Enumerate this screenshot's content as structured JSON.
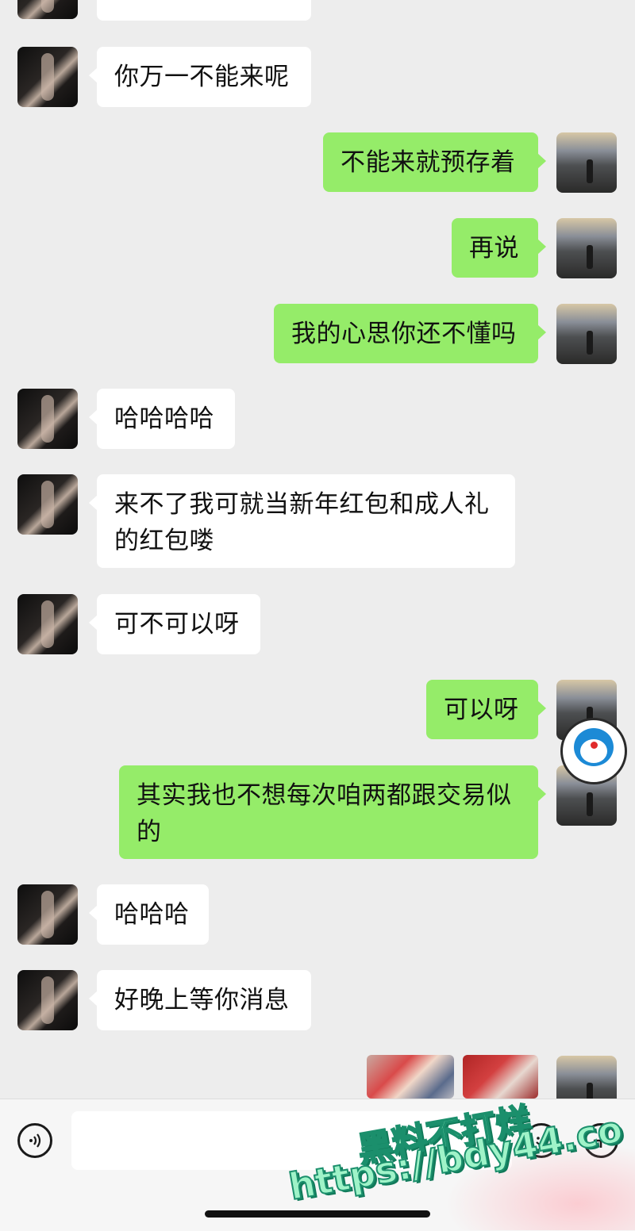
{
  "messages": [
    {
      "side": "left",
      "text": ""
    },
    {
      "side": "left",
      "text": "你万一不能来呢"
    },
    {
      "side": "right",
      "text": "不能来就预存着"
    },
    {
      "side": "right",
      "text": "再说"
    },
    {
      "side": "right",
      "text": "我的心思你还不懂吗"
    },
    {
      "side": "left",
      "text": "哈哈哈哈"
    },
    {
      "side": "left",
      "text": "来不了我可就当新年红包和成人礼的红包喽"
    },
    {
      "side": "left",
      "text": "可不可以呀"
    },
    {
      "side": "right",
      "text": "可以呀"
    },
    {
      "side": "right",
      "text": "其实我也不想每次咱两都跟交易似的"
    },
    {
      "side": "left",
      "text": "哈哈哈"
    },
    {
      "side": "left",
      "text": "好晚上等你消息"
    }
  ],
  "image_message": {
    "side": "right",
    "icon": "image-thumbnail"
  },
  "input_bar": {
    "voice_icon": "voice-icon",
    "emoji_icon": "emoji-icon",
    "plus_icon": "plus-icon",
    "input_value": ""
  },
  "watermark": {
    "line1": "黑料不打烊",
    "line2": "https://bdy44.co"
  },
  "colors": {
    "background": "#ededed",
    "incoming_bubble": "#ffffff",
    "outgoing_bubble": "#95ec69"
  }
}
